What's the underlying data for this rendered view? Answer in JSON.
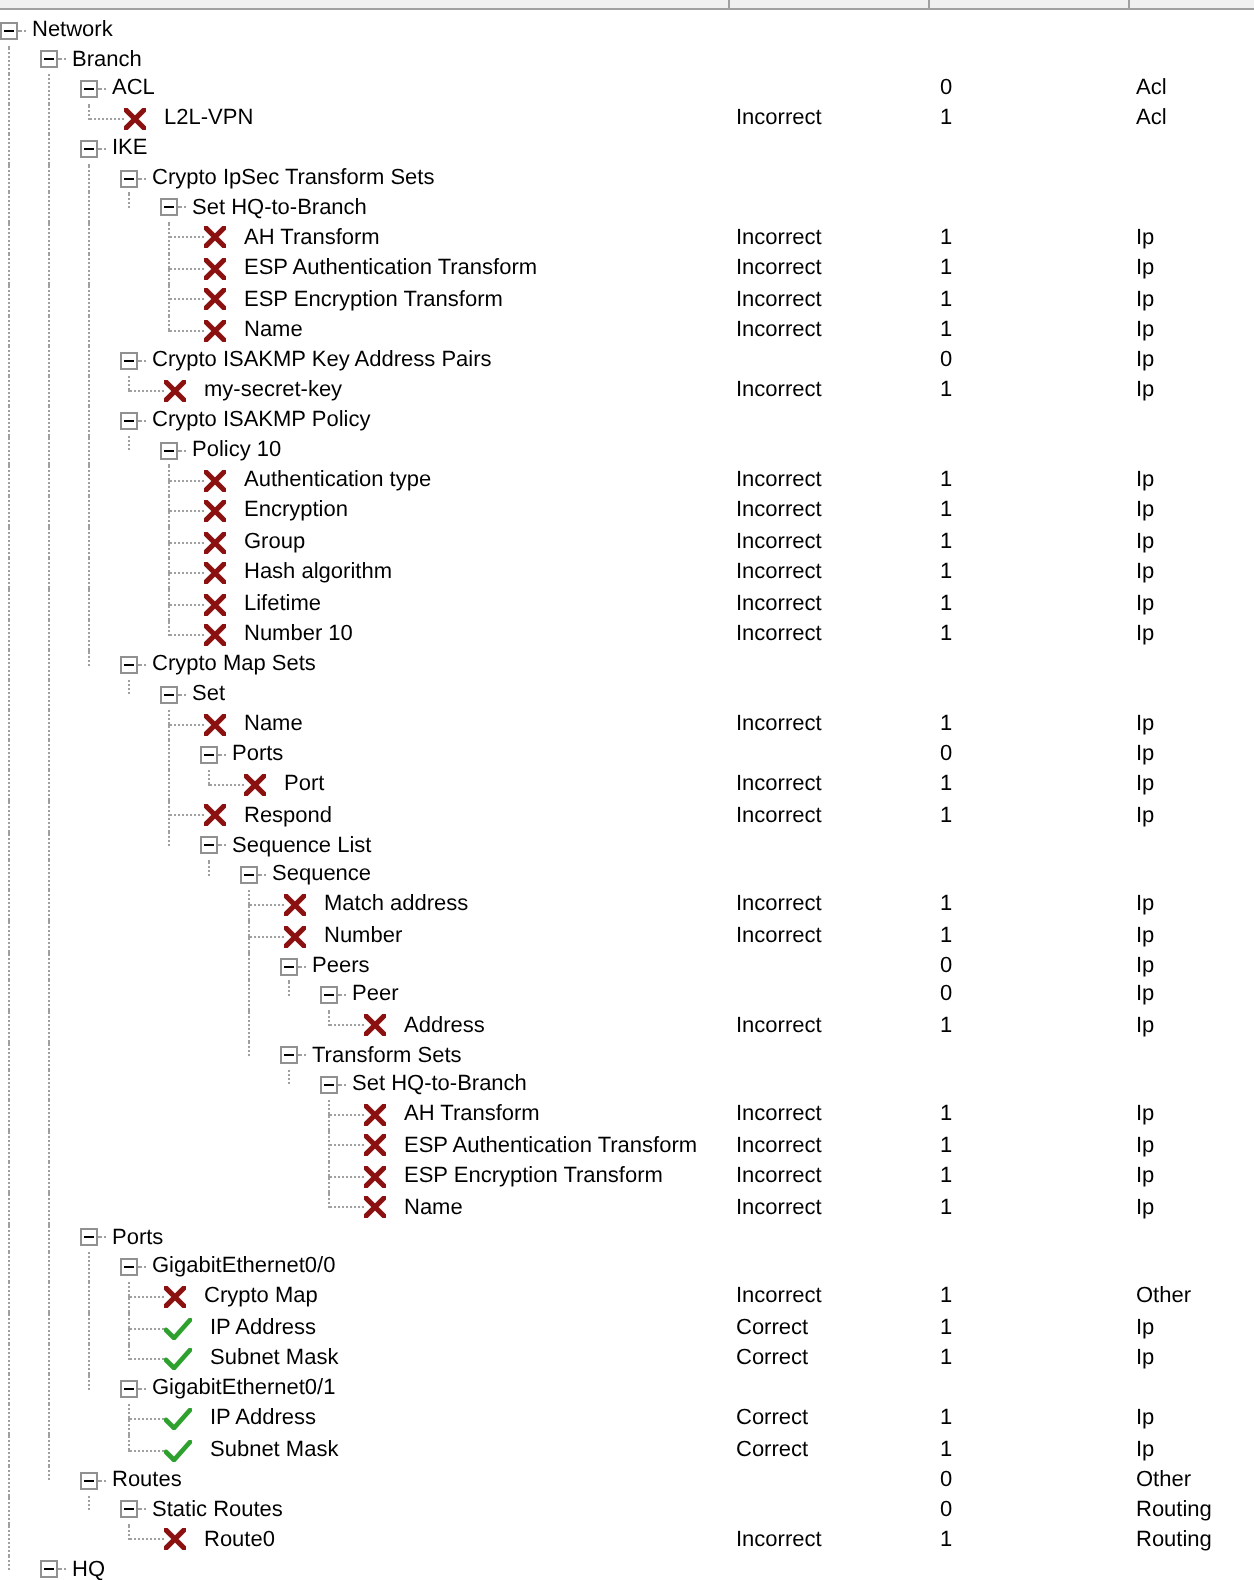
{
  "tree": [
    {
      "label": "Network",
      "expanded": true,
      "children": [
        {
          "label": "Branch",
          "expanded": true,
          "children": [
            {
              "label": "ACL",
              "expanded": true,
              "points": "0",
              "component": "Acl",
              "children": [
                {
                  "label": "L2L-VPN",
                  "kind": "incorrect",
                  "status": "Incorrect",
                  "points": "1",
                  "component": "Acl"
                }
              ]
            },
            {
              "label": "IKE",
              "expanded": true,
              "children": [
                {
                  "label": "Crypto IpSec Transform Sets",
                  "expanded": true,
                  "children": [
                    {
                      "label": "Set HQ-to-Branch",
                      "expanded": true,
                      "children": [
                        {
                          "label": "AH Transform",
                          "kind": "incorrect",
                          "status": "Incorrect",
                          "points": "1",
                          "component": "Ip"
                        },
                        {
                          "label": "ESP Authentication Transform",
                          "kind": "incorrect",
                          "status": "Incorrect",
                          "points": "1",
                          "component": "Ip"
                        },
                        {
                          "label": "ESP Encryption Transform",
                          "kind": "incorrect",
                          "status": "Incorrect",
                          "points": "1",
                          "component": "Ip"
                        },
                        {
                          "label": "Name",
                          "kind": "incorrect",
                          "status": "Incorrect",
                          "points": "1",
                          "component": "Ip"
                        }
                      ]
                    }
                  ]
                },
                {
                  "label": "Crypto ISAKMP Key Address Pairs",
                  "expanded": true,
                  "points": "0",
                  "component": "Ip",
                  "children": [
                    {
                      "label": "my-secret-key",
                      "kind": "incorrect",
                      "status": "Incorrect",
                      "points": "1",
                      "component": "Ip"
                    }
                  ]
                },
                {
                  "label": "Crypto ISAKMP Policy",
                  "expanded": true,
                  "children": [
                    {
                      "label": "Policy 10",
                      "expanded": true,
                      "children": [
                        {
                          "label": "Authentication type",
                          "kind": "incorrect",
                          "status": "Incorrect",
                          "points": "1",
                          "component": "Ip"
                        },
                        {
                          "label": "Encryption",
                          "kind": "incorrect",
                          "status": "Incorrect",
                          "points": "1",
                          "component": "Ip"
                        },
                        {
                          "label": "Group",
                          "kind": "incorrect",
                          "status": "Incorrect",
                          "points": "1",
                          "component": "Ip"
                        },
                        {
                          "label": "Hash algorithm",
                          "kind": "incorrect",
                          "status": "Incorrect",
                          "points": "1",
                          "component": "Ip"
                        },
                        {
                          "label": "Lifetime",
                          "kind": "incorrect",
                          "status": "Incorrect",
                          "points": "1",
                          "component": "Ip"
                        },
                        {
                          "label": "Number 10",
                          "kind": "incorrect",
                          "status": "Incorrect",
                          "points": "1",
                          "component": "Ip"
                        }
                      ]
                    }
                  ]
                },
                {
                  "label": "Crypto Map Sets",
                  "expanded": true,
                  "children": [
                    {
                      "label": "Set",
                      "expanded": true,
                      "children": [
                        {
                          "label": "Name",
                          "kind": "incorrect",
                          "status": "Incorrect",
                          "points": "1",
                          "component": "Ip"
                        },
                        {
                          "label": "Ports",
                          "expanded": true,
                          "points": "0",
                          "component": "Ip",
                          "children": [
                            {
                              "label": "Port",
                              "kind": "incorrect",
                              "status": "Incorrect",
                              "points": "1",
                              "component": "Ip"
                            }
                          ]
                        },
                        {
                          "label": "Respond",
                          "kind": "incorrect",
                          "status": "Incorrect",
                          "points": "1",
                          "component": "Ip"
                        },
                        {
                          "label": "Sequence List",
                          "expanded": true,
                          "children": [
                            {
                              "label": "Sequence",
                              "expanded": true,
                              "children": [
                                {
                                  "label": "Match address",
                                  "kind": "incorrect",
                                  "status": "Incorrect",
                                  "points": "1",
                                  "component": "Ip"
                                },
                                {
                                  "label": "Number",
                                  "kind": "incorrect",
                                  "status": "Incorrect",
                                  "points": "1",
                                  "component": "Ip"
                                },
                                {
                                  "label": "Peers",
                                  "expanded": true,
                                  "points": "0",
                                  "component": "Ip",
                                  "children": [
                                    {
                                      "label": "Peer",
                                      "expanded": true,
                                      "points": "0",
                                      "component": "Ip",
                                      "children": [
                                        {
                                          "label": "Address",
                                          "kind": "incorrect",
                                          "status": "Incorrect",
                                          "points": "1",
                                          "component": "Ip"
                                        }
                                      ]
                                    }
                                  ]
                                },
                                {
                                  "label": "Transform Sets",
                                  "expanded": true,
                                  "children": [
                                    {
                                      "label": "Set HQ-to-Branch",
                                      "expanded": true,
                                      "children": [
                                        {
                                          "label": "AH Transform",
                                          "kind": "incorrect",
                                          "status": "Incorrect",
                                          "points": "1",
                                          "component": "Ip"
                                        },
                                        {
                                          "label": "ESP Authentication Transform",
                                          "kind": "incorrect",
                                          "status": "Incorrect",
                                          "points": "1",
                                          "component": "Ip"
                                        },
                                        {
                                          "label": "ESP Encryption Transform",
                                          "kind": "incorrect",
                                          "status": "Incorrect",
                                          "points": "1",
                                          "component": "Ip"
                                        },
                                        {
                                          "label": "Name",
                                          "kind": "incorrect",
                                          "status": "Incorrect",
                                          "points": "1",
                                          "component": "Ip"
                                        }
                                      ]
                                    }
                                  ]
                                }
                              ]
                            }
                          ]
                        }
                      ]
                    }
                  ]
                }
              ]
            },
            {
              "label": "Ports",
              "expanded": true,
              "children": [
                {
                  "label": "GigabitEthernet0/0",
                  "expanded": true,
                  "children": [
                    {
                      "label": "Crypto Map",
                      "kind": "incorrect",
                      "status": "Incorrect",
                      "points": "1",
                      "component": "Other"
                    },
                    {
                      "label": "IP Address",
                      "kind": "correct",
                      "status": "Correct",
                      "points": "1",
                      "component": "Ip"
                    },
                    {
                      "label": "Subnet Mask",
                      "kind": "correct",
                      "status": "Correct",
                      "points": "1",
                      "component": "Ip"
                    }
                  ]
                },
                {
                  "label": "GigabitEthernet0/1",
                  "expanded": true,
                  "children": [
                    {
                      "label": "IP Address",
                      "kind": "correct",
                      "status": "Correct",
                      "points": "1",
                      "component": "Ip"
                    },
                    {
                      "label": "Subnet Mask",
                      "kind": "correct",
                      "status": "Correct",
                      "points": "1",
                      "component": "Ip"
                    }
                  ]
                }
              ]
            },
            {
              "label": "Routes",
              "expanded": true,
              "points": "0",
              "component": "Other",
              "children": [
                {
                  "label": "Static Routes",
                  "expanded": true,
                  "points": "0",
                  "component": "Routing",
                  "children": [
                    {
                      "label": "Route0",
                      "kind": "incorrect",
                      "status": "Incorrect",
                      "points": "1",
                      "component": "Routing"
                    }
                  ]
                }
              ]
            }
          ]
        },
        {
          "label": "HQ",
          "expanded": true
        }
      ]
    }
  ]
}
